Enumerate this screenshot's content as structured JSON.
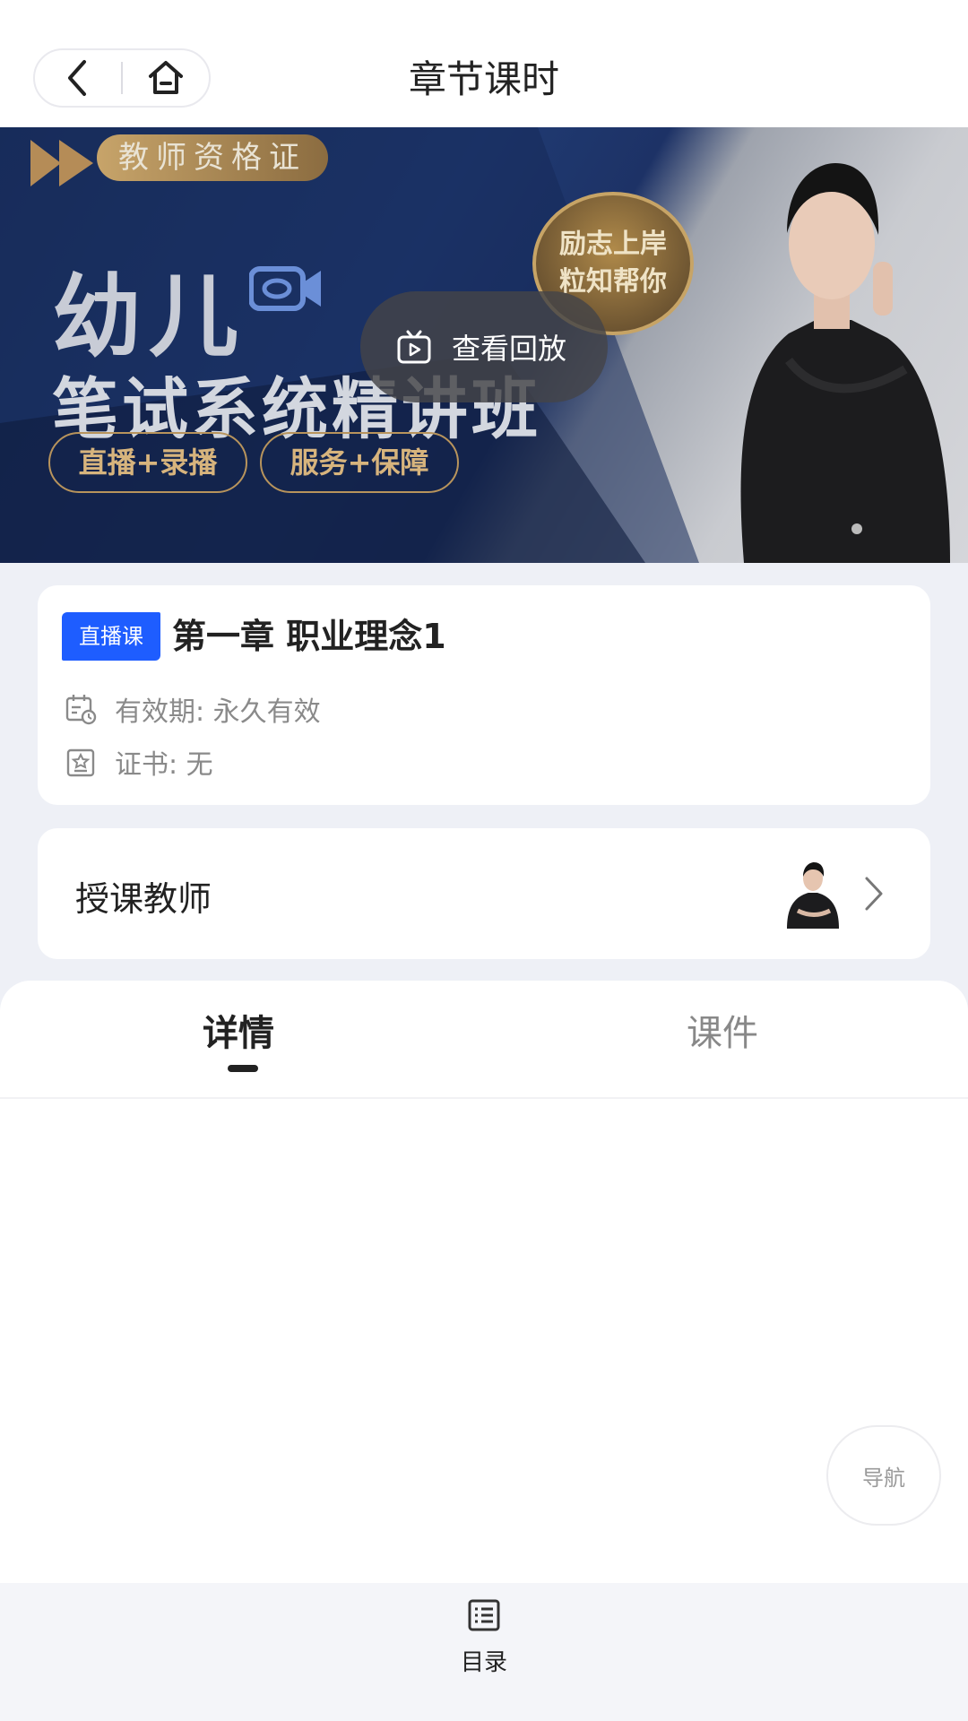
{
  "header": {
    "title": "章节课时",
    "back_icon": "chevron-left-icon",
    "home_icon": "home-icon"
  },
  "banner": {
    "badge": "教师资格证",
    "headline_1": "幼儿",
    "headline_2": "笔试系统精讲班",
    "pill_1": "直播+录播",
    "pill_2": "服务+保障",
    "seal_line_1": "励志上岸",
    "seal_line_2": "粒知帮你",
    "playback_label": "查看回放",
    "playback_icon": "tv-play-icon"
  },
  "course": {
    "type_badge": "直播课",
    "title": "第一章 职业理念1",
    "validity": "有效期: 永久有效",
    "certificate": "证书: 无",
    "validity_icon": "calendar-clock-icon",
    "certificate_icon": "certificate-icon"
  },
  "teacher": {
    "label": "授课教师"
  },
  "tabs": {
    "detail": "详情",
    "courseware": "课件",
    "active": "详情"
  },
  "nav_fab": {
    "label": "导航"
  },
  "bottom_bar": {
    "catalog_label": "目录",
    "catalog_icon": "list-icon"
  },
  "colors": {
    "accent": "#1e5dff",
    "background": "#eef0f6"
  }
}
